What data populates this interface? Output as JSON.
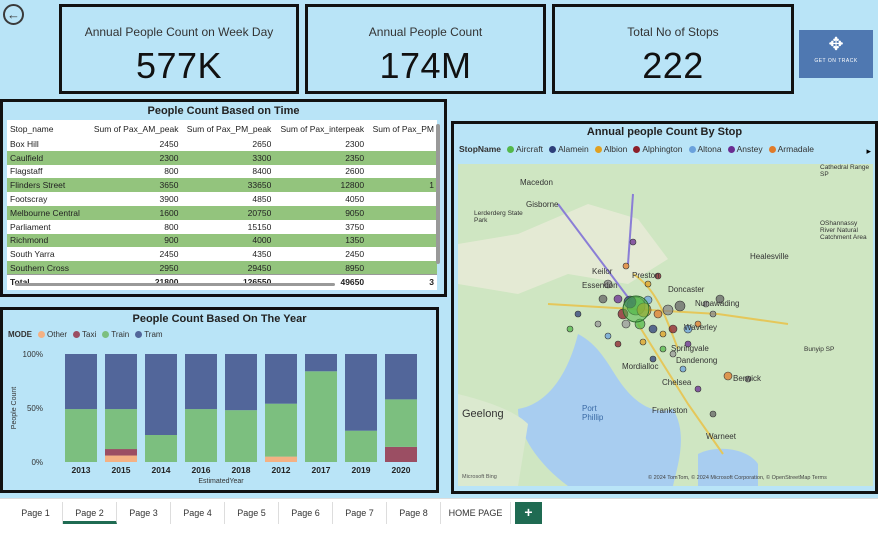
{
  "kpis": [
    {
      "title": "Annual People Count on Week Day",
      "value": "577K"
    },
    {
      "title": "Annual People Count",
      "value": "174M"
    },
    {
      "title": "Total No of Stops",
      "value": "222"
    }
  ],
  "logo": {
    "text": "GET ON TRACK"
  },
  "table": {
    "title": "People Count Based on Time",
    "columns": [
      "Stop_name",
      "Sum of Pax_AM_peak",
      "Sum of Pax_PM_peak",
      "Sum of Pax_interpeak",
      "Sum of Pax_PM"
    ],
    "rows": [
      [
        "Box Hill",
        "2450",
        "2650",
        "2300",
        ""
      ],
      [
        "Caulfield",
        "2300",
        "3300",
        "2350",
        ""
      ],
      [
        "Flagstaff",
        "800",
        "8400",
        "2600",
        ""
      ],
      [
        "Flinders Street",
        "3650",
        "33650",
        "12800",
        "1"
      ],
      [
        "Footscray",
        "3900",
        "4850",
        "4050",
        ""
      ],
      [
        "Melbourne Central",
        "1600",
        "20750",
        "9050",
        ""
      ],
      [
        "Parliament",
        "800",
        "15150",
        "3750",
        ""
      ],
      [
        "Richmond",
        "900",
        "4000",
        "1350",
        ""
      ],
      [
        "South Yarra",
        "2450",
        "4350",
        "2450",
        ""
      ],
      [
        "Southern Cross",
        "2950",
        "29450",
        "8950",
        ""
      ]
    ],
    "total": [
      "Total",
      "21800",
      "126550",
      "49650",
      "3"
    ]
  },
  "bar_chart_title": "People Count Based On The Year",
  "bar_legend_label": "MODE",
  "chart_data": {
    "type": "bar",
    "stacked": "100%",
    "title": "People Count Based On The Year",
    "xlabel": "EstimatedYear",
    "ylabel": "People Count",
    "yticks": [
      "100%",
      "50%",
      "0%"
    ],
    "categories": [
      "2013",
      "2015",
      "2014",
      "2016",
      "2018",
      "2012",
      "2017",
      "2019",
      "2020"
    ],
    "series": [
      {
        "name": "Other",
        "color": "#f4b183",
        "values": [
          0,
          6,
          0,
          0,
          0,
          5,
          0,
          0,
          0
        ]
      },
      {
        "name": "Taxi",
        "color": "#9b4e63",
        "values": [
          0,
          6,
          0,
          0,
          0,
          0,
          0,
          0,
          14
        ]
      },
      {
        "name": "Train",
        "color": "#7cbf7f",
        "values": [
          49,
          37,
          25,
          49,
          48,
          49,
          84,
          29,
          44
        ]
      },
      {
        "name": "Tram",
        "color": "#52669a",
        "values": [
          51,
          51,
          75,
          51,
          52,
          46,
          16,
          71,
          42
        ]
      }
    ]
  },
  "map": {
    "title": "Annual people Count By Stop",
    "legend_label": "StopName",
    "legend": [
      {
        "name": "Aircraft",
        "color": "#54b84a"
      },
      {
        "name": "Alamein",
        "color": "#2d3f7a"
      },
      {
        "name": "Albion",
        "color": "#e0a020"
      },
      {
        "name": "Alphington",
        "color": "#8c1f2a"
      },
      {
        "name": "Altona",
        "color": "#6aa1dc"
      },
      {
        "name": "Anstey",
        "color": "#6a2c91"
      },
      {
        "name": "Armadale",
        "color": "#e07b2a"
      }
    ],
    "places": [
      "Macedon",
      "Gisborne",
      "Lerderderg State Park",
      "Keilor",
      "Essendon",
      "Preston",
      "Doncaster",
      "Nunawading",
      "Waverley",
      "Springvale",
      "Dandenong",
      "Mordialloc",
      "Chelsea",
      "Berwick",
      "Frankston",
      "Geelong",
      "Port Phillip",
      "Healesville",
      "Warneet",
      "Cathedral Range SP",
      "OShannassy River Natural Catchment Area",
      "Bunyip SP"
    ],
    "attribution": "© 2024 TomTom, © 2024 Microsoft Corporation, © OpenStreetMap  Terms",
    "brand": "Microsoft Bing"
  },
  "tabs": {
    "items": [
      "Page 1",
      "Page 2",
      "Page 3",
      "Page 4",
      "Page 5",
      "Page 6",
      "Page 7",
      "Page 8",
      "HOME PAGE"
    ],
    "active": "Page 2",
    "add_label": "+"
  }
}
